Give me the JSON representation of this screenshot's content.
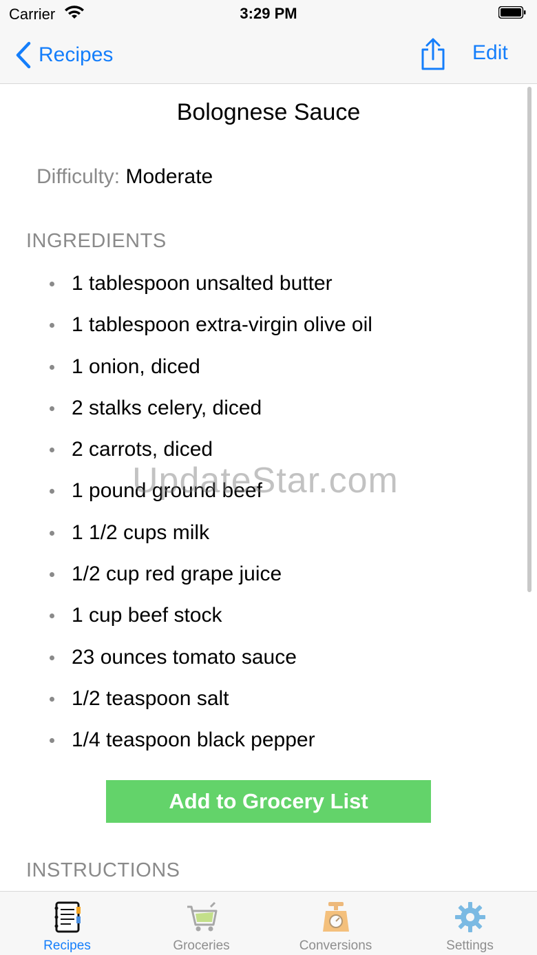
{
  "status_bar": {
    "carrier": "Carrier",
    "time": "3:29 PM"
  },
  "nav": {
    "back_label": "Recipes",
    "edit_label": "Edit",
    "accent_color": "#147efb"
  },
  "recipe": {
    "title": "Bolognese Sauce",
    "difficulty_label": "Difficulty:",
    "difficulty_value": "Moderate",
    "ingredients_header": "INGREDIENTS",
    "ingredients": [
      "1 tablespoon unsalted butter",
      "1 tablespoon extra-virgin olive oil",
      "1 onion, diced",
      "2 stalks celery, diced",
      "2 carrots, diced",
      "1 pound ground beef",
      "1 1/2 cups milk",
      "1/2 cup red grape juice",
      "1 cup beef stock",
      "23 ounces tomato sauce",
      "1/2 teaspoon salt",
      "1/4 teaspoon black pepper"
    ],
    "add_button_label": "Add to Grocery List",
    "add_button_color": "#63d36a",
    "instructions_header": "INSTRUCTIONS"
  },
  "watermark": "UpdateStar.com",
  "tabs": [
    {
      "label": "Recipes",
      "icon": "notebook-icon",
      "active": true
    },
    {
      "label": "Groceries",
      "icon": "shopping-cart-icon",
      "active": false
    },
    {
      "label": "Conversions",
      "icon": "kitchen-scale-icon",
      "active": false
    },
    {
      "label": "Settings",
      "icon": "gear-icon",
      "active": false
    }
  ]
}
